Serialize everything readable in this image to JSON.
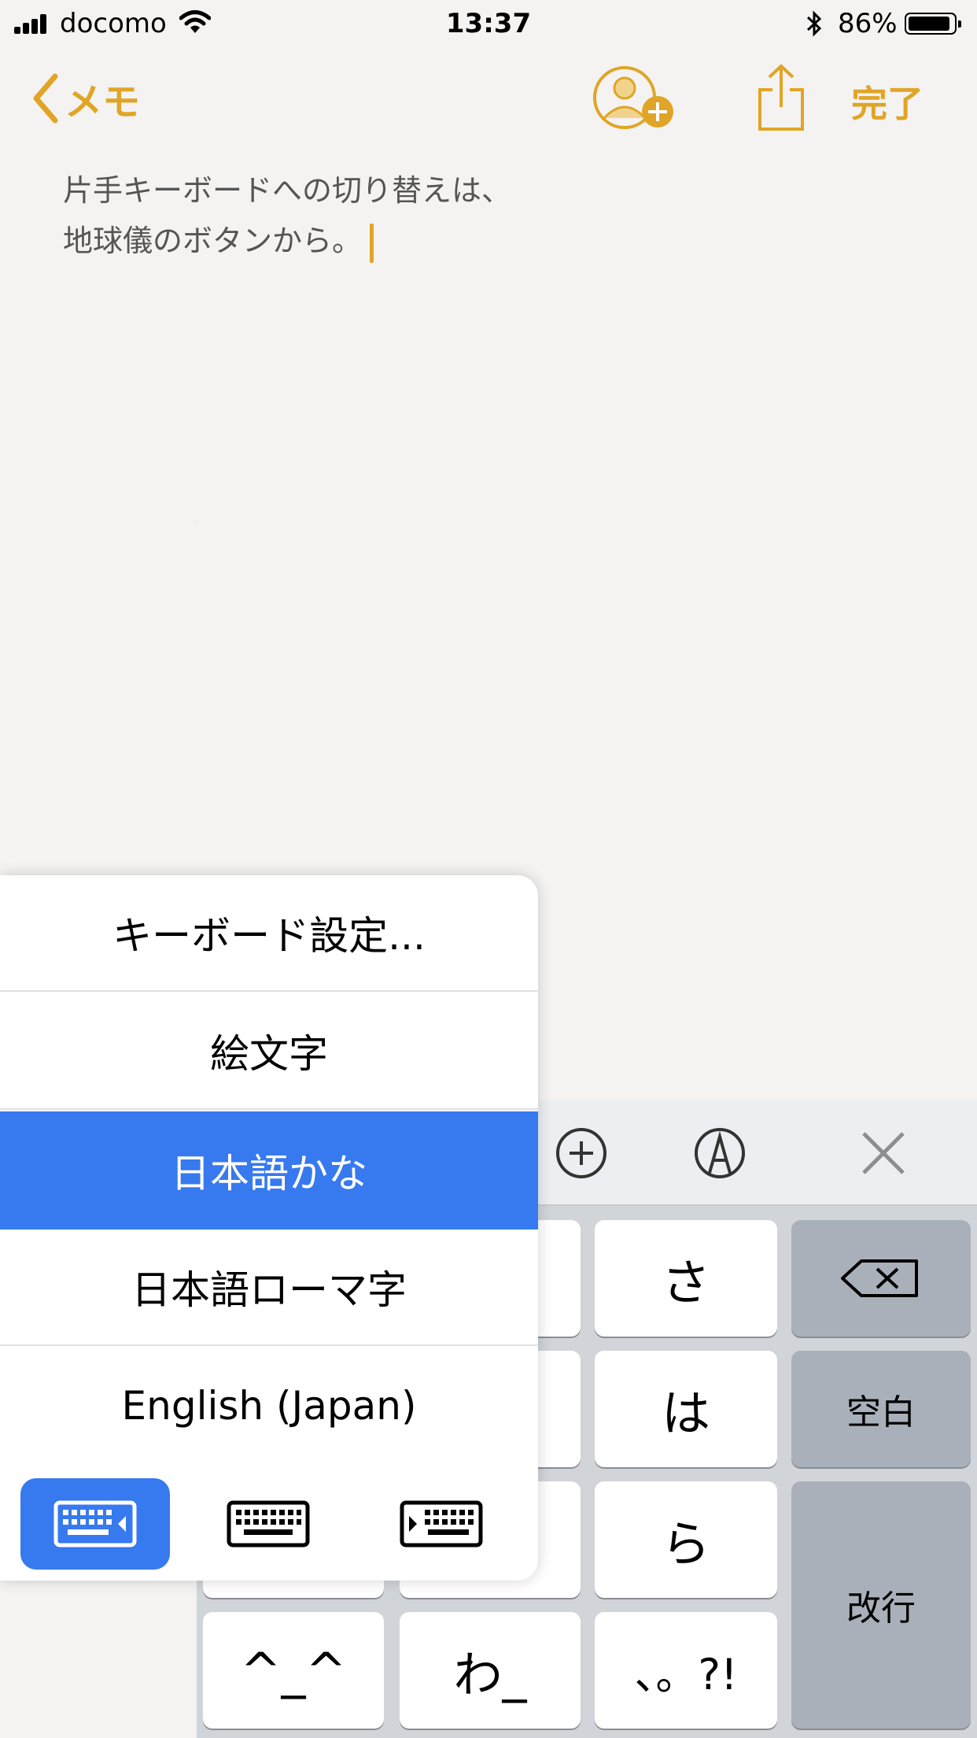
{
  "status_bar": {
    "carrier": "docomo",
    "time": "13:37",
    "battery": "86%"
  },
  "nav": {
    "back_label": "メモ",
    "done_label": "完了"
  },
  "note": {
    "line1": "片手キーボードへの切り替えは、",
    "line2": "地球儀のボタンから。"
  },
  "menu": {
    "items": [
      {
        "label": "キーボード設定..."
      },
      {
        "label": "絵文字"
      },
      {
        "label": "日本語かな",
        "selected": true
      },
      {
        "label": "日本語ローマ字"
      },
      {
        "label": "English (Japan)"
      }
    ],
    "modes": [
      "keyboard-left-icon",
      "keyboard-full-icon",
      "keyboard-right-icon"
    ],
    "active_mode": "keyboard-left-icon"
  },
  "keyboard": {
    "keys": {
      "sa": "さ",
      "ha": "は",
      "ra": "ら",
      "kaomoji": "^_^",
      "wa": "わ_",
      "punct": "、。?!",
      "space": "空白",
      "return": "改行"
    }
  },
  "colors": {
    "accent": "#e0a526",
    "selection": "#3779ee",
    "background": "#f4f3f2"
  }
}
